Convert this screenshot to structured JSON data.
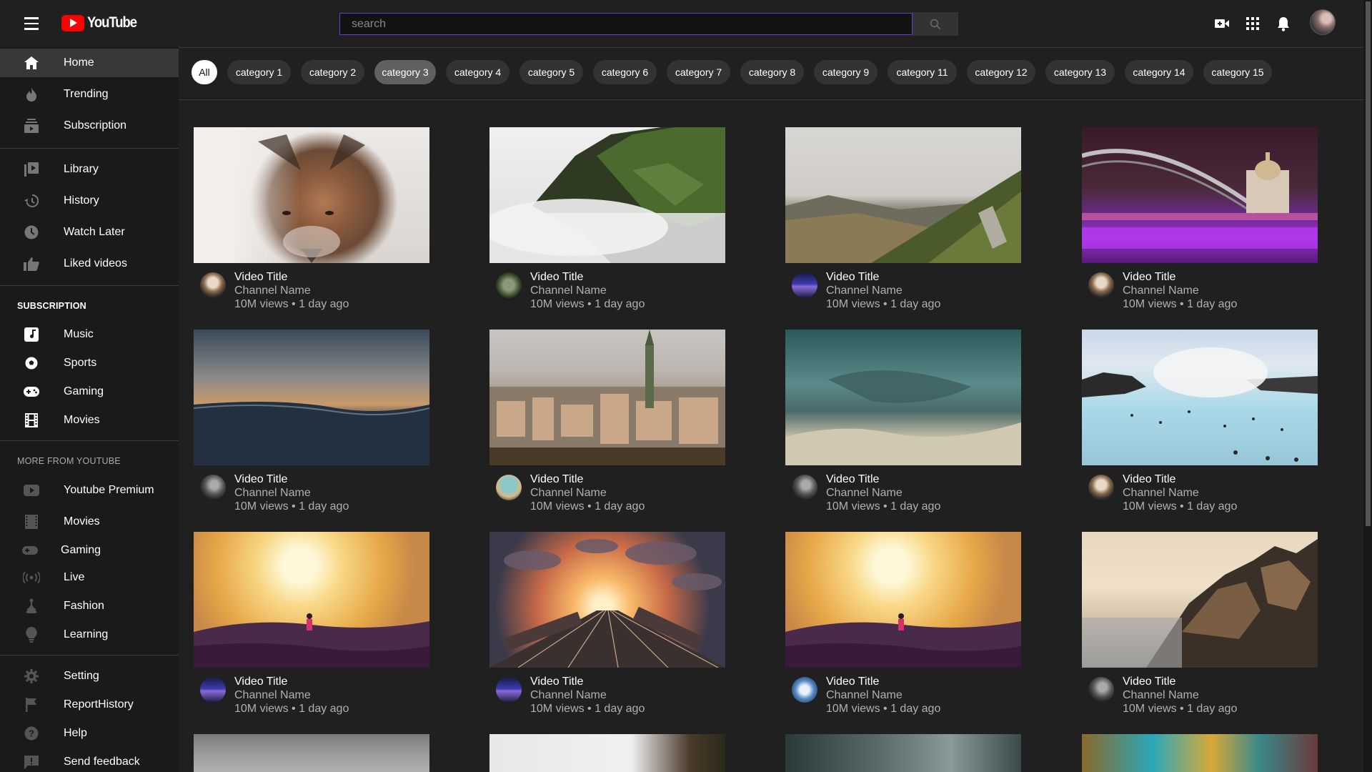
{
  "header": {
    "logo_text": "YouTube",
    "search_placeholder": "search",
    "icons": [
      "menu-icon",
      "youtube-logo-icon",
      "search-icon",
      "video-camera-icon",
      "apps-grid-icon",
      "bell-icon",
      "avatar"
    ]
  },
  "sidebar": {
    "main": [
      {
        "label": "Home",
        "icon": "home-icon",
        "active": true
      },
      {
        "label": "Trending",
        "icon": "fire-icon"
      },
      {
        "label": "Subscription",
        "icon": "subscriptions-icon"
      }
    ],
    "library": [
      {
        "label": "Library",
        "icon": "library-icon"
      },
      {
        "label": "History",
        "icon": "history-icon"
      },
      {
        "label": "Watch Later",
        "icon": "clock-icon"
      },
      {
        "label": "Liked videos",
        "icon": "thumbs-up-icon"
      }
    ],
    "subscription_heading": "SUBSCRIPTION",
    "subscriptions": [
      {
        "label": "Music",
        "icon": "music-note-icon"
      },
      {
        "label": "Sports",
        "icon": "soccer-ball-icon"
      },
      {
        "label": "Gaming",
        "icon": "gamepad-icon"
      },
      {
        "label": "Movies",
        "icon": "film-icon"
      }
    ],
    "more_heading": "MORE FROM YOUTUBE",
    "more": [
      {
        "label": "Youtube Premium",
        "icon": "youtube-icon"
      },
      {
        "label": "Movies",
        "icon": "film-icon"
      },
      {
        "label": "Gaming",
        "icon": "gamepad-icon"
      },
      {
        "label": "Live",
        "icon": "live-broadcast-icon"
      },
      {
        "label": "Fashion",
        "icon": "hanger-icon"
      },
      {
        "label": "Learning",
        "icon": "lightbulb-icon"
      }
    ],
    "settings": [
      {
        "label": "Setting",
        "icon": "gear-icon"
      },
      {
        "label": "ReportHistory",
        "icon": "flag-icon"
      },
      {
        "label": "Help",
        "icon": "help-icon"
      },
      {
        "label": "Send feedback",
        "icon": "feedback-icon"
      }
    ]
  },
  "chips": [
    "All",
    "category 1",
    "category 2",
    "category 3",
    "category 4",
    "category 5",
    "category 6",
    "category 7",
    "category 8",
    "category 9",
    "category 11",
    "category 12",
    "category 13",
    "category 14",
    "category 15"
  ],
  "chips_selected": [
    "All",
    "category 3"
  ],
  "videos": [
    {
      "title": "Video Title",
      "channel": "Channel Name",
      "meta": "10M views • 1 day ago",
      "thumb": "fox"
    },
    {
      "title": "Video Title",
      "channel": "Channel Name",
      "meta": "10M views • 1 day ago",
      "thumb": "cliff-fog"
    },
    {
      "title": "Video Title",
      "channel": "Channel Name",
      "meta": "10M views • 1 day ago",
      "thumb": "hills"
    },
    {
      "title": "Video Title",
      "channel": "Channel Name",
      "meta": "10M views • 1 day ago",
      "thumb": "bridge-night"
    },
    {
      "title": "Video Title",
      "channel": "Channel Name",
      "meta": "10M views • 1 day ago",
      "thumb": "ocean-dusk"
    },
    {
      "title": "Video Title",
      "channel": "Channel Name",
      "meta": "10M views • 1 day ago",
      "thumb": "old-town"
    },
    {
      "title": "Video Title",
      "channel": "Channel Name",
      "meta": "10M views • 1 day ago",
      "thumb": "teal-sky"
    },
    {
      "title": "Video Title",
      "channel": "Channel Name",
      "meta": "10M views • 1 day ago",
      "thumb": "lagoon"
    },
    {
      "title": "Video Title",
      "channel": "Channel Name",
      "meta": "10M views • 1 day ago",
      "thumb": "sunrise-field"
    },
    {
      "title": "Video Title",
      "channel": "Channel Name",
      "meta": "10M views • 1 day ago",
      "thumb": "rail-sunset"
    },
    {
      "title": "Video Title",
      "channel": "Channel Name",
      "meta": "10M views • 1 day ago",
      "thumb": "sunrise-field"
    },
    {
      "title": "Video Title",
      "channel": "Channel Name",
      "meta": "10M views • 1 day ago",
      "thumb": "coast-rocks"
    }
  ],
  "partial_thumbs": [
    "cloudy-sky",
    "tree-sky",
    "rain-glass",
    "colorful-abstract"
  ],
  "colors": {
    "background": "#202020",
    "sidebar": "#1a1a1a",
    "chip": "#333333",
    "chip_selected": "#606060",
    "search_border": "#6a3bd8",
    "brand_red": "#ff0000"
  }
}
